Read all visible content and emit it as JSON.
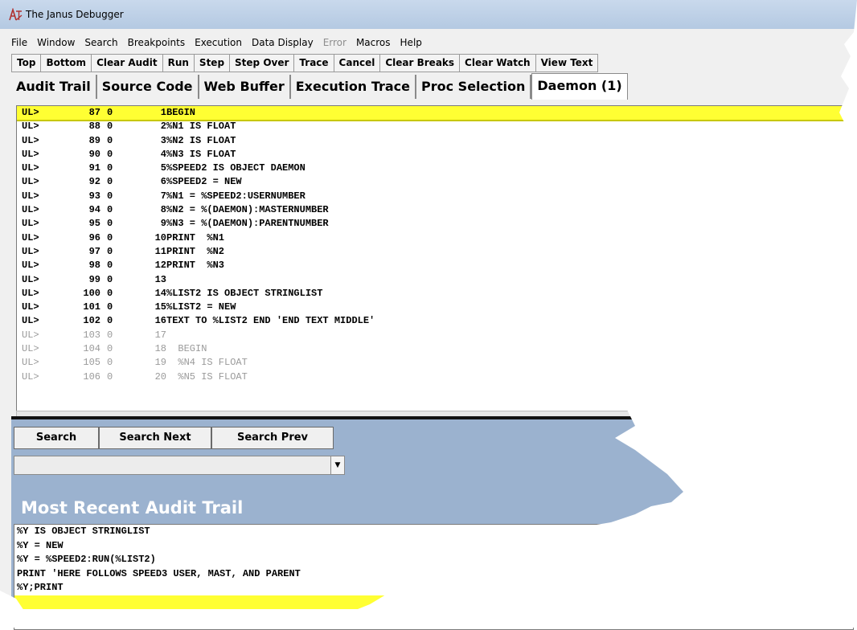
{
  "window": {
    "title": "The Janus Debugger"
  },
  "menu": [
    "File",
    "Window",
    "Search",
    "Breakpoints",
    "Execution",
    "Data Display",
    "Error",
    "Macros",
    "Help"
  ],
  "menu_disabled": [
    "Error"
  ],
  "toolbar": [
    "Top",
    "Bottom",
    "Clear Audit",
    "Run",
    "Step",
    "Step Over",
    "Trace",
    "Cancel",
    "Clear Breaks",
    "Clear Watch",
    "View Text"
  ],
  "tabs": [
    "Audit Trail",
    "Source Code",
    "Web Buffer",
    "Execution Trace",
    "Proc Selection",
    "Daemon (1)"
  ],
  "active_tab": "Daemon (1)",
  "code_lines": [
    {
      "prefix": "UL>",
      "line": "87",
      "flag": "0",
      "stmt": "1",
      "text": "BEGIN",
      "state": "current"
    },
    {
      "prefix": "UL>",
      "line": "88",
      "flag": "0",
      "stmt": "2",
      "text": "%N1 IS FLOAT",
      "state": "normal"
    },
    {
      "prefix": "UL>",
      "line": "89",
      "flag": "0",
      "stmt": "3",
      "text": "%N2 IS FLOAT",
      "state": "normal"
    },
    {
      "prefix": "UL>",
      "line": "90",
      "flag": "0",
      "stmt": "4",
      "text": "%N3 IS FLOAT",
      "state": "normal"
    },
    {
      "prefix": "UL>",
      "line": "91",
      "flag": "0",
      "stmt": "5",
      "text": "%SPEED2 IS OBJECT DAEMON",
      "state": "normal"
    },
    {
      "prefix": "UL>",
      "line": "92",
      "flag": "0",
      "stmt": "6",
      "text": "%SPEED2 = NEW",
      "state": "normal"
    },
    {
      "prefix": "UL>",
      "line": "93",
      "flag": "0",
      "stmt": "7",
      "text": "%N1 = %SPEED2:USERNUMBER",
      "state": "normal"
    },
    {
      "prefix": "UL>",
      "line": "94",
      "flag": "0",
      "stmt": "8",
      "text": "%N2 = %(DAEMON):MASTERNUMBER",
      "state": "normal"
    },
    {
      "prefix": "UL>",
      "line": "95",
      "flag": "0",
      "stmt": "9",
      "text": "%N3 = %(DAEMON):PARENTNUMBER",
      "state": "normal"
    },
    {
      "prefix": "UL>",
      "line": "96",
      "flag": "0",
      "stmt": "10",
      "text": "PRINT  %N1",
      "state": "normal"
    },
    {
      "prefix": "UL>",
      "line": "97",
      "flag": "0",
      "stmt": "11",
      "text": "PRINT  %N2",
      "state": "normal"
    },
    {
      "prefix": "UL>",
      "line": "98",
      "flag": "0",
      "stmt": "12",
      "text": "PRINT  %N3",
      "state": "normal"
    },
    {
      "prefix": "UL>",
      "line": "99",
      "flag": "0",
      "stmt": "13",
      "text": "",
      "state": "normal"
    },
    {
      "prefix": "UL>",
      "line": "100",
      "flag": "0",
      "stmt": "14",
      "text": "%LIST2 IS OBJECT STRINGLIST",
      "state": "normal"
    },
    {
      "prefix": "UL>",
      "line": "101",
      "flag": "0",
      "stmt": "15",
      "text": "%LIST2 = NEW",
      "state": "normal"
    },
    {
      "prefix": "UL>",
      "line": "102",
      "flag": "0",
      "stmt": "16",
      "text": "TEXT TO %LIST2 END 'END TEXT MIDDLE'",
      "state": "normal"
    },
    {
      "prefix": "UL>",
      "line": "103",
      "flag": "0",
      "stmt": "17",
      "text": "",
      "state": "dim"
    },
    {
      "prefix": "UL>",
      "line": "104",
      "flag": "0",
      "stmt": "18",
      "text": "  BEGIN",
      "state": "dim"
    },
    {
      "prefix": "UL>",
      "line": "105",
      "flag": "0",
      "stmt": "19",
      "text": "  %N4 IS FLOAT",
      "state": "dim"
    },
    {
      "prefix": "UL>",
      "line": "106",
      "flag": "0",
      "stmt": "20",
      "text": "  %N5 IS FLOAT",
      "state": "dim"
    }
  ],
  "search": {
    "search_label": "Search",
    "search_next_label": "Search Next",
    "search_prev_label": "Search Prev",
    "combo_value": ""
  },
  "audit": {
    "heading": "Most Recent Audit Trail",
    "lines": [
      "%Y IS OBJECT STRINGLIST",
      "%Y = NEW",
      "%Y = %SPEED2:RUN(%LIST2)",
      "PRINT 'HERE FOLLOWS SPEED3 USER, MAST, AND PARENT",
      "%Y;PRINT",
      ""
    ],
    "highlight_index": 5
  },
  "colors": {
    "highlight": "#ffff33",
    "panel_bg": "#9bb2cf",
    "audit_heading": "#ffffff"
  },
  "icons": {
    "app": "janus-debugger-icon",
    "dropdown": "dropdown-arrow-icon"
  }
}
